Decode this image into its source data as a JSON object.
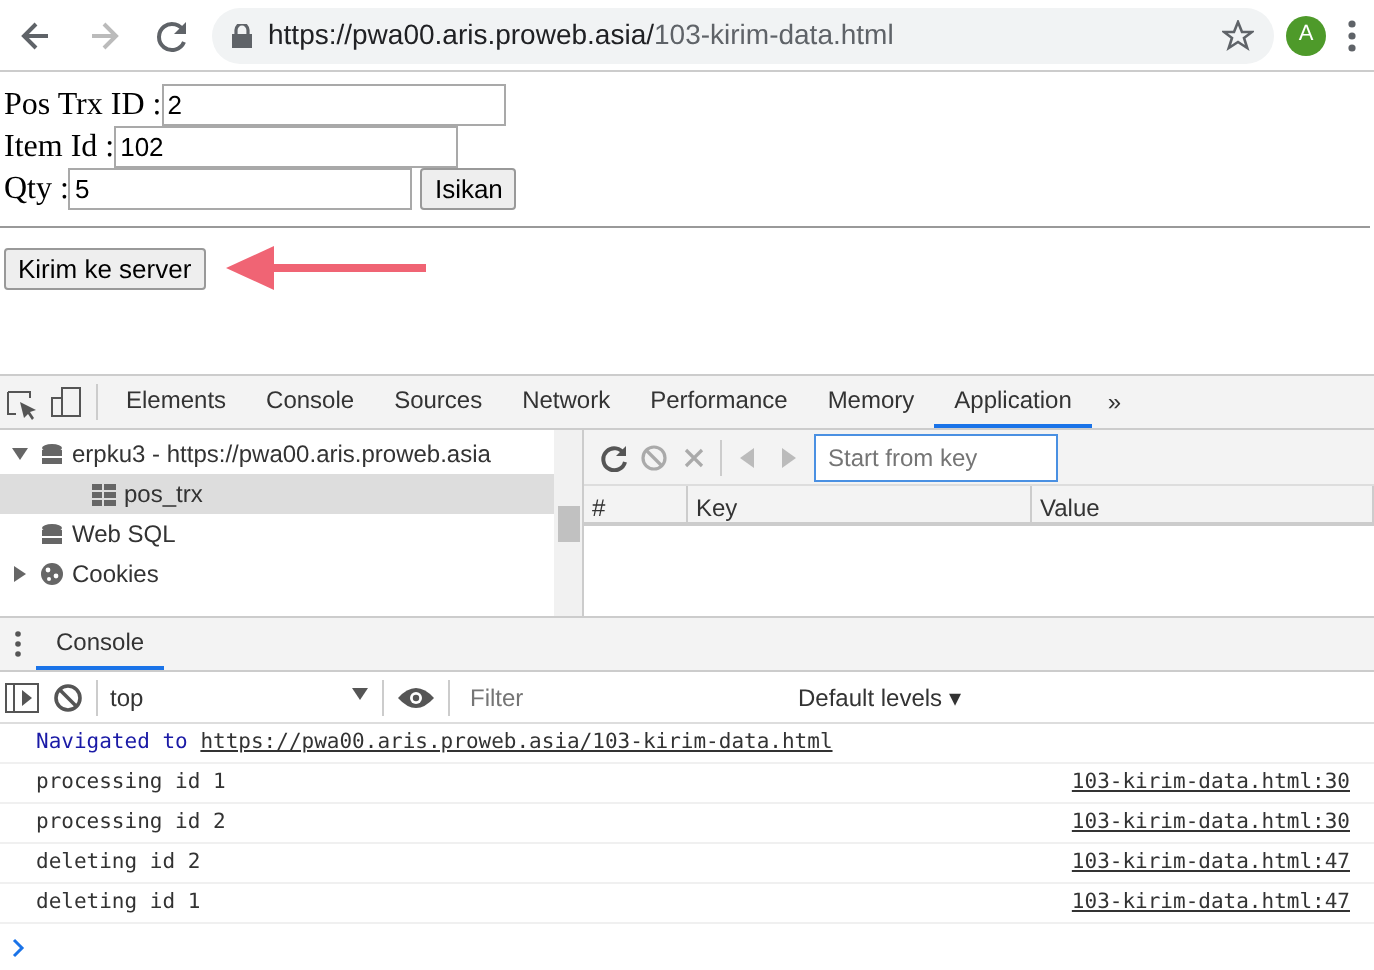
{
  "browser": {
    "url_host": "https://pwa00.aris.proweb.asia/",
    "url_path": "103-kirim-data.html",
    "avatar": "A"
  },
  "form": {
    "fields": [
      {
        "label": "Pos Trx ID :",
        "value": "2"
      },
      {
        "label": "Item Id :",
        "value": "102"
      },
      {
        "label": "Qty :",
        "value": "5"
      }
    ],
    "fill_button": "Isikan",
    "send_button": "Kirim ke server"
  },
  "devtools": {
    "tabs": [
      {
        "label": "Elements",
        "selected": false
      },
      {
        "label": "Console",
        "selected": false
      },
      {
        "label": "Sources",
        "selected": false
      },
      {
        "label": "Network",
        "selected": false
      },
      {
        "label": "Performance",
        "selected": false
      },
      {
        "label": "Memory",
        "selected": false
      },
      {
        "label": "Application",
        "selected": true
      }
    ],
    "more": "»",
    "sidebar": {
      "items": [
        {
          "label": "erpku3 - https://pwa00.aris.proweb.asia",
          "kind": "database",
          "expanded": true,
          "selected": false,
          "children": [
            {
              "label": "pos_trx",
              "kind": "table",
              "selected": true
            }
          ]
        },
        {
          "label": "Web SQL",
          "kind": "database",
          "selected": false
        },
        {
          "label": "Cookies",
          "kind": "cookie",
          "expanded": false,
          "selected": false
        }
      ]
    },
    "key_search": {
      "placeholder": "Start from key"
    },
    "table": {
      "columns": [
        "#",
        "Key",
        "Value"
      ]
    }
  },
  "drawer": {
    "tabs": [
      {
        "label": "Console",
        "selected": true
      }
    ],
    "context": "top",
    "filter": {
      "placeholder": "Filter"
    },
    "levels": "Default levels ▾",
    "messages": [
      {
        "kind": "navigation",
        "text": "Navigated to",
        "link": "https://pwa00.aris.proweb.asia/103-kirim-data.html"
      },
      {
        "kind": "log",
        "text": "processing id 1",
        "source": "103-kirim-data.html:30"
      },
      {
        "kind": "log",
        "text": "processing id 2",
        "source": "103-kirim-data.html:30"
      },
      {
        "kind": "log",
        "text": "deleting id 2",
        "source": "103-kirim-data.html:47"
      },
      {
        "kind": "log",
        "text": "deleting id 1",
        "source": "103-kirim-data.html:47"
      }
    ]
  }
}
